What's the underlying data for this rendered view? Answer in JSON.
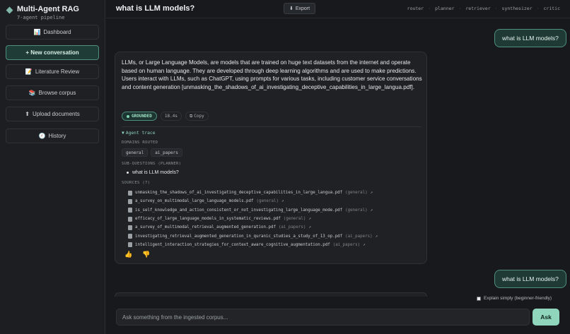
{
  "sidebar": {
    "brand_title": "Multi-Agent RAG",
    "brand_subtitle": "7-agent pipeline",
    "items": [
      {
        "label": "Dashboard",
        "icon": "📊"
      },
      {
        "label": "+ New conversation",
        "icon": ""
      },
      {
        "label": "Literature Review",
        "icon": "📝"
      },
      {
        "label": "Browse corpus",
        "icon": "📚"
      },
      {
        "label": "Upload documents",
        "icon": "⬆"
      },
      {
        "label": "History",
        "icon": "🕘"
      }
    ]
  },
  "header": {
    "title": "what is LLM models?",
    "export_label": "Export",
    "export_icon": "⬇",
    "pipeline": [
      "router",
      "planner",
      "retriever",
      "synthesizer",
      "critic"
    ]
  },
  "conversation": {
    "user_message_1": "what is LLM models?",
    "user_message_2": "what is LLM models?",
    "answer": {
      "text": "LLMs, or Large Language Models, are models that are trained on huge text datasets from the internet and operate based on human language. They are developed through deep learning algorithms and are used to make predictions. Users interact with LLMs, such as ChatGPT, using prompts for various tasks, including customer service conversations and content generation [unmasking_the_shadows_of_ai_investigating_deceptive_capabilities_in_large_langua.pdf].",
      "status": "GROUNDED",
      "latency": "18.4s",
      "copy_label": "Copy",
      "copy_icon": "⧉",
      "trace": {
        "toggle_label": "Agent trace",
        "toggle_icon": "▼",
        "domains_label": "DOMAINS ROUTED",
        "domains": [
          "general",
          "ai_papers"
        ],
        "subq_label": "SUB-QUESTIONS (PLANNER)",
        "subquestions": [
          "what is LLM models?"
        ],
        "sources_label": "SOURCES (7)",
        "sources": [
          {
            "file": "unmasking_the_shadows_of_ai_investigating_deceptive_capabilities_in_large_langua.pdf",
            "domain": "(general)"
          },
          {
            "file": "a_survey_on_multimodal_large_language_models.pdf",
            "domain": "(general)"
          },
          {
            "file": "is_self_knowledge_and_action_consistent_or_not_investigating_large_language_mode.pdf",
            "domain": "(general)"
          },
          {
            "file": "efficacy_of_large_language_models_in_systematic_reviews.pdf",
            "domain": "(general)"
          },
          {
            "file": "a_survey_of_multimodal_retrieval_augmented_generation.pdf",
            "domain": "(ai_papers)"
          },
          {
            "file": "investigating_retrieval_augmented_generation_in_quranic_studies_a_study_of_13_op.pdf",
            "domain": "(ai_papers)"
          },
          {
            "file": "intelligent_interaction_strategies_for_context_aware_cognitive_augmentation.pdf",
            "domain": "(ai_papers)"
          }
        ]
      },
      "feedback": {
        "up": "👍",
        "down": "👎"
      }
    }
  },
  "composer": {
    "explain_label": "Explain simply (beginner-friendly)",
    "placeholder": "Ask something from the ingested corpus...",
    "ask_label": "Ask"
  },
  "colors": {
    "accent": "#8fd6bd",
    "accent_border": "#4f8f7d",
    "background": "#17191c",
    "card": "#1f2124"
  }
}
